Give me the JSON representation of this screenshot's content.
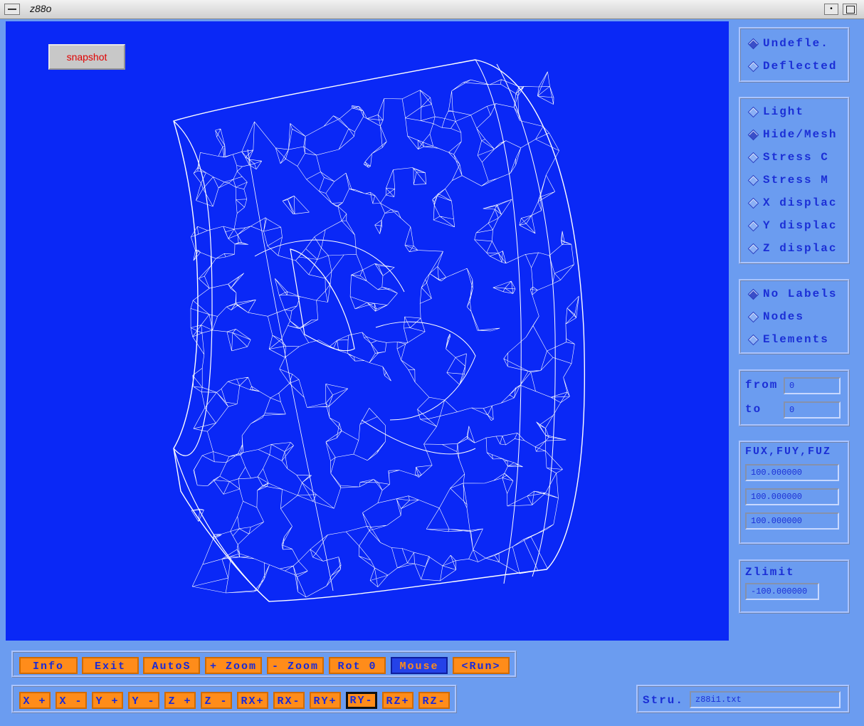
{
  "window": {
    "title": "z88o"
  },
  "canvas": {
    "snapshot_label": "snapshot"
  },
  "display_mode": {
    "items": [
      {
        "label": "Undefle.",
        "selected": true
      },
      {
        "label": "Deflected",
        "selected": false
      }
    ]
  },
  "render_mode": {
    "items": [
      {
        "label": "Light",
        "selected": false
      },
      {
        "label": "Hide/Mesh",
        "selected": true
      },
      {
        "label": "Stress C",
        "selected": false
      },
      {
        "label": "Stress M",
        "selected": false
      },
      {
        "label": "X displac",
        "selected": false
      },
      {
        "label": "Y displac",
        "selected": false
      },
      {
        "label": "Z displac",
        "selected": false
      }
    ]
  },
  "labels_mode": {
    "items": [
      {
        "label": "No Labels",
        "selected": true
      },
      {
        "label": "Nodes",
        "selected": false
      },
      {
        "label": "Elements",
        "selected": false
      }
    ]
  },
  "range": {
    "from_label": "from",
    "from_value": "0",
    "to_label": "to",
    "to_value": "0"
  },
  "factors": {
    "label": "FUX,FUY,FUZ",
    "fux": "100.000000",
    "fuy": "100.000000",
    "fuz": "100.000000"
  },
  "zlimit": {
    "label": "Zlimit",
    "value": "-100.000000"
  },
  "toolbar1": [
    "Info",
    "Exit",
    "AutoS",
    "+ Zoom",
    "- Zoom",
    "Rot 0",
    "Mouse",
    "<Run>"
  ],
  "toolbar2": [
    "X +",
    "X -",
    "Y +",
    "Y -",
    "Z +",
    "Z -",
    "RX+",
    "RX-",
    "RY+",
    "RY-",
    "RZ+",
    "RZ-"
  ],
  "structure": {
    "label": "Stru.",
    "value": "z88i1.txt"
  },
  "colors": {
    "canvas_bg": "#0a28f6",
    "panel_bg": "#6b9cf0",
    "button_orange": "#ff8c1a",
    "mesh": "#ffffff"
  }
}
